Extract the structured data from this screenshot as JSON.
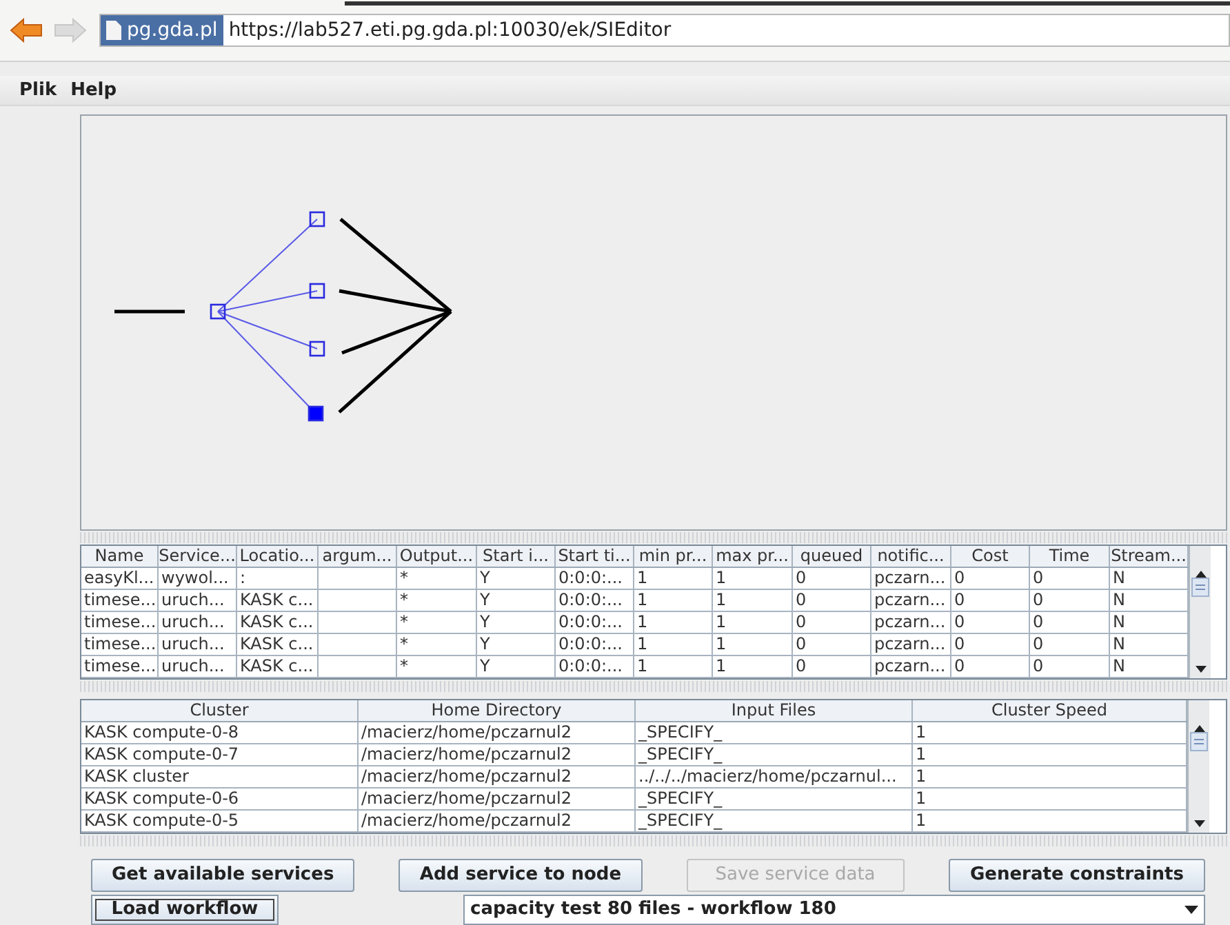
{
  "browser": {
    "site_badge": "pg.gda.pl",
    "url": "https://lab527.eti.pg.gda.pl:10030/ek/SIEditor"
  },
  "menu": [
    "Plik",
    "Help"
  ],
  "graph": {
    "nodes": [
      {
        "selected": false
      },
      {
        "selected": false
      },
      {
        "selected": false
      },
      {
        "selected": false
      },
      {
        "selected": true
      }
    ]
  },
  "services_table": {
    "columns": [
      "Name",
      "Service...",
      "Locatio...",
      "argum...",
      "Output...",
      "Start i...",
      "Start ti...",
      "min pr...",
      "max pr...",
      "queued",
      "notific...",
      "Cost",
      "Time",
      "Stream..."
    ],
    "rows": [
      [
        "easyKl...",
        "wywol...",
        ":",
        "",
        "*",
        "Y",
        "0:0:0:...",
        "1",
        "1",
        "0",
        "pczarn...",
        "0",
        "0",
        "N"
      ],
      [
        "timese...",
        "uruch...",
        "KASK c...",
        "",
        "*",
        "Y",
        "0:0:0:...",
        "1",
        "1",
        "0",
        "pczarn...",
        "0",
        "0",
        "N"
      ],
      [
        "timese...",
        "uruch...",
        "KASK c...",
        "",
        "*",
        "Y",
        "0:0:0:...",
        "1",
        "1",
        "0",
        "pczarn...",
        "0",
        "0",
        "N"
      ],
      [
        "timese...",
        "uruch...",
        "KASK c...",
        "",
        "*",
        "Y",
        "0:0:0:...",
        "1",
        "1",
        "0",
        "pczarn...",
        "0",
        "0",
        "N"
      ],
      [
        "timese...",
        "uruch...",
        "KASK c...",
        "",
        "*",
        "Y",
        "0:0:0:...",
        "1",
        "1",
        "0",
        "pczarn...",
        "0",
        "0",
        "N"
      ]
    ]
  },
  "clusters_table": {
    "columns": [
      "Cluster",
      "Home Directory",
      "Input Files",
      "Cluster Speed"
    ],
    "rows": [
      [
        "KASK compute-0-8",
        "/macierz/home/pczarnul2",
        "_SPECIFY_",
        "1"
      ],
      [
        "KASK compute-0-7",
        "/macierz/home/pczarnul2",
        "_SPECIFY_",
        "1"
      ],
      [
        "KASK cluster",
        "/macierz/home/pczarnul2",
        "../../../macierz/home/pczarnul...",
        "1"
      ],
      [
        "KASK compute-0-6",
        "/macierz/home/pczarnul2",
        "_SPECIFY_",
        "1"
      ],
      [
        "KASK compute-0-5",
        "/macierz/home/pczarnul2",
        "_SPECIFY_",
        "1"
      ]
    ]
  },
  "buttons": [
    {
      "label": "Get available services",
      "disabled": false
    },
    {
      "label": "Add service to node",
      "disabled": false
    },
    {
      "label": "Save service data",
      "disabled": true
    },
    {
      "label": "Generate constraints",
      "disabled": false
    }
  ],
  "load_button": {
    "label": "Load workflow",
    "focused": true
  },
  "workflow_select": {
    "value": "capacity test 80 files - workflow 180"
  }
}
